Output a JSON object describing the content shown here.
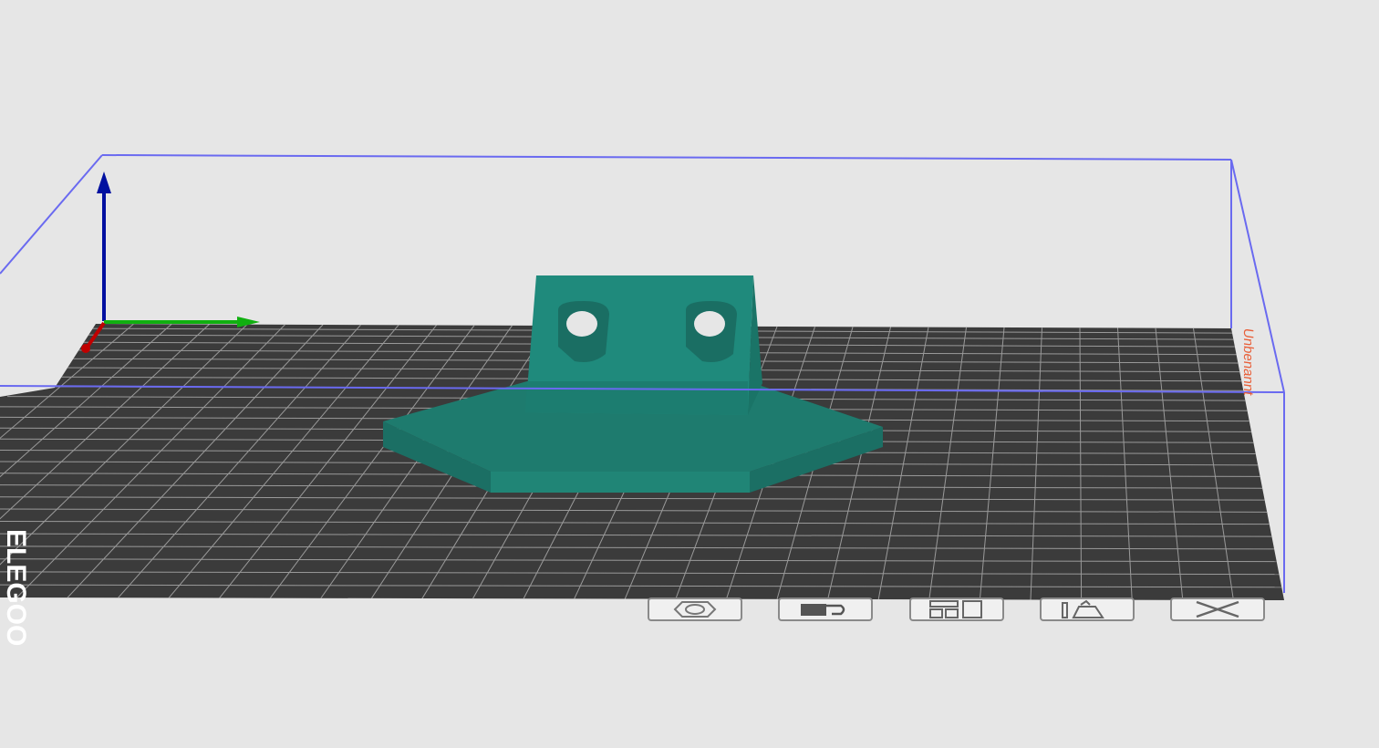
{
  "viewport": {
    "bed_label": "Unbenannt",
    "bed_logo": "ELEGOO",
    "colors": {
      "background": "#e6e6e6",
      "bed": "#3b3b3b",
      "grid": "#9a9a9a",
      "bounding_box": "#6a6af0",
      "model": "#1f8a7c",
      "axis_x": "#c00000",
      "axis_y": "#10b010",
      "axis_z": "#0010a0",
      "label": "#e8603a"
    }
  },
  "toolbar": {
    "buttons": [
      {
        "name": "nut-icon"
      },
      {
        "name": "toggle-icon"
      },
      {
        "name": "arrange-icon"
      },
      {
        "name": "load-folder-icon"
      },
      {
        "name": "close-icon"
      }
    ]
  }
}
